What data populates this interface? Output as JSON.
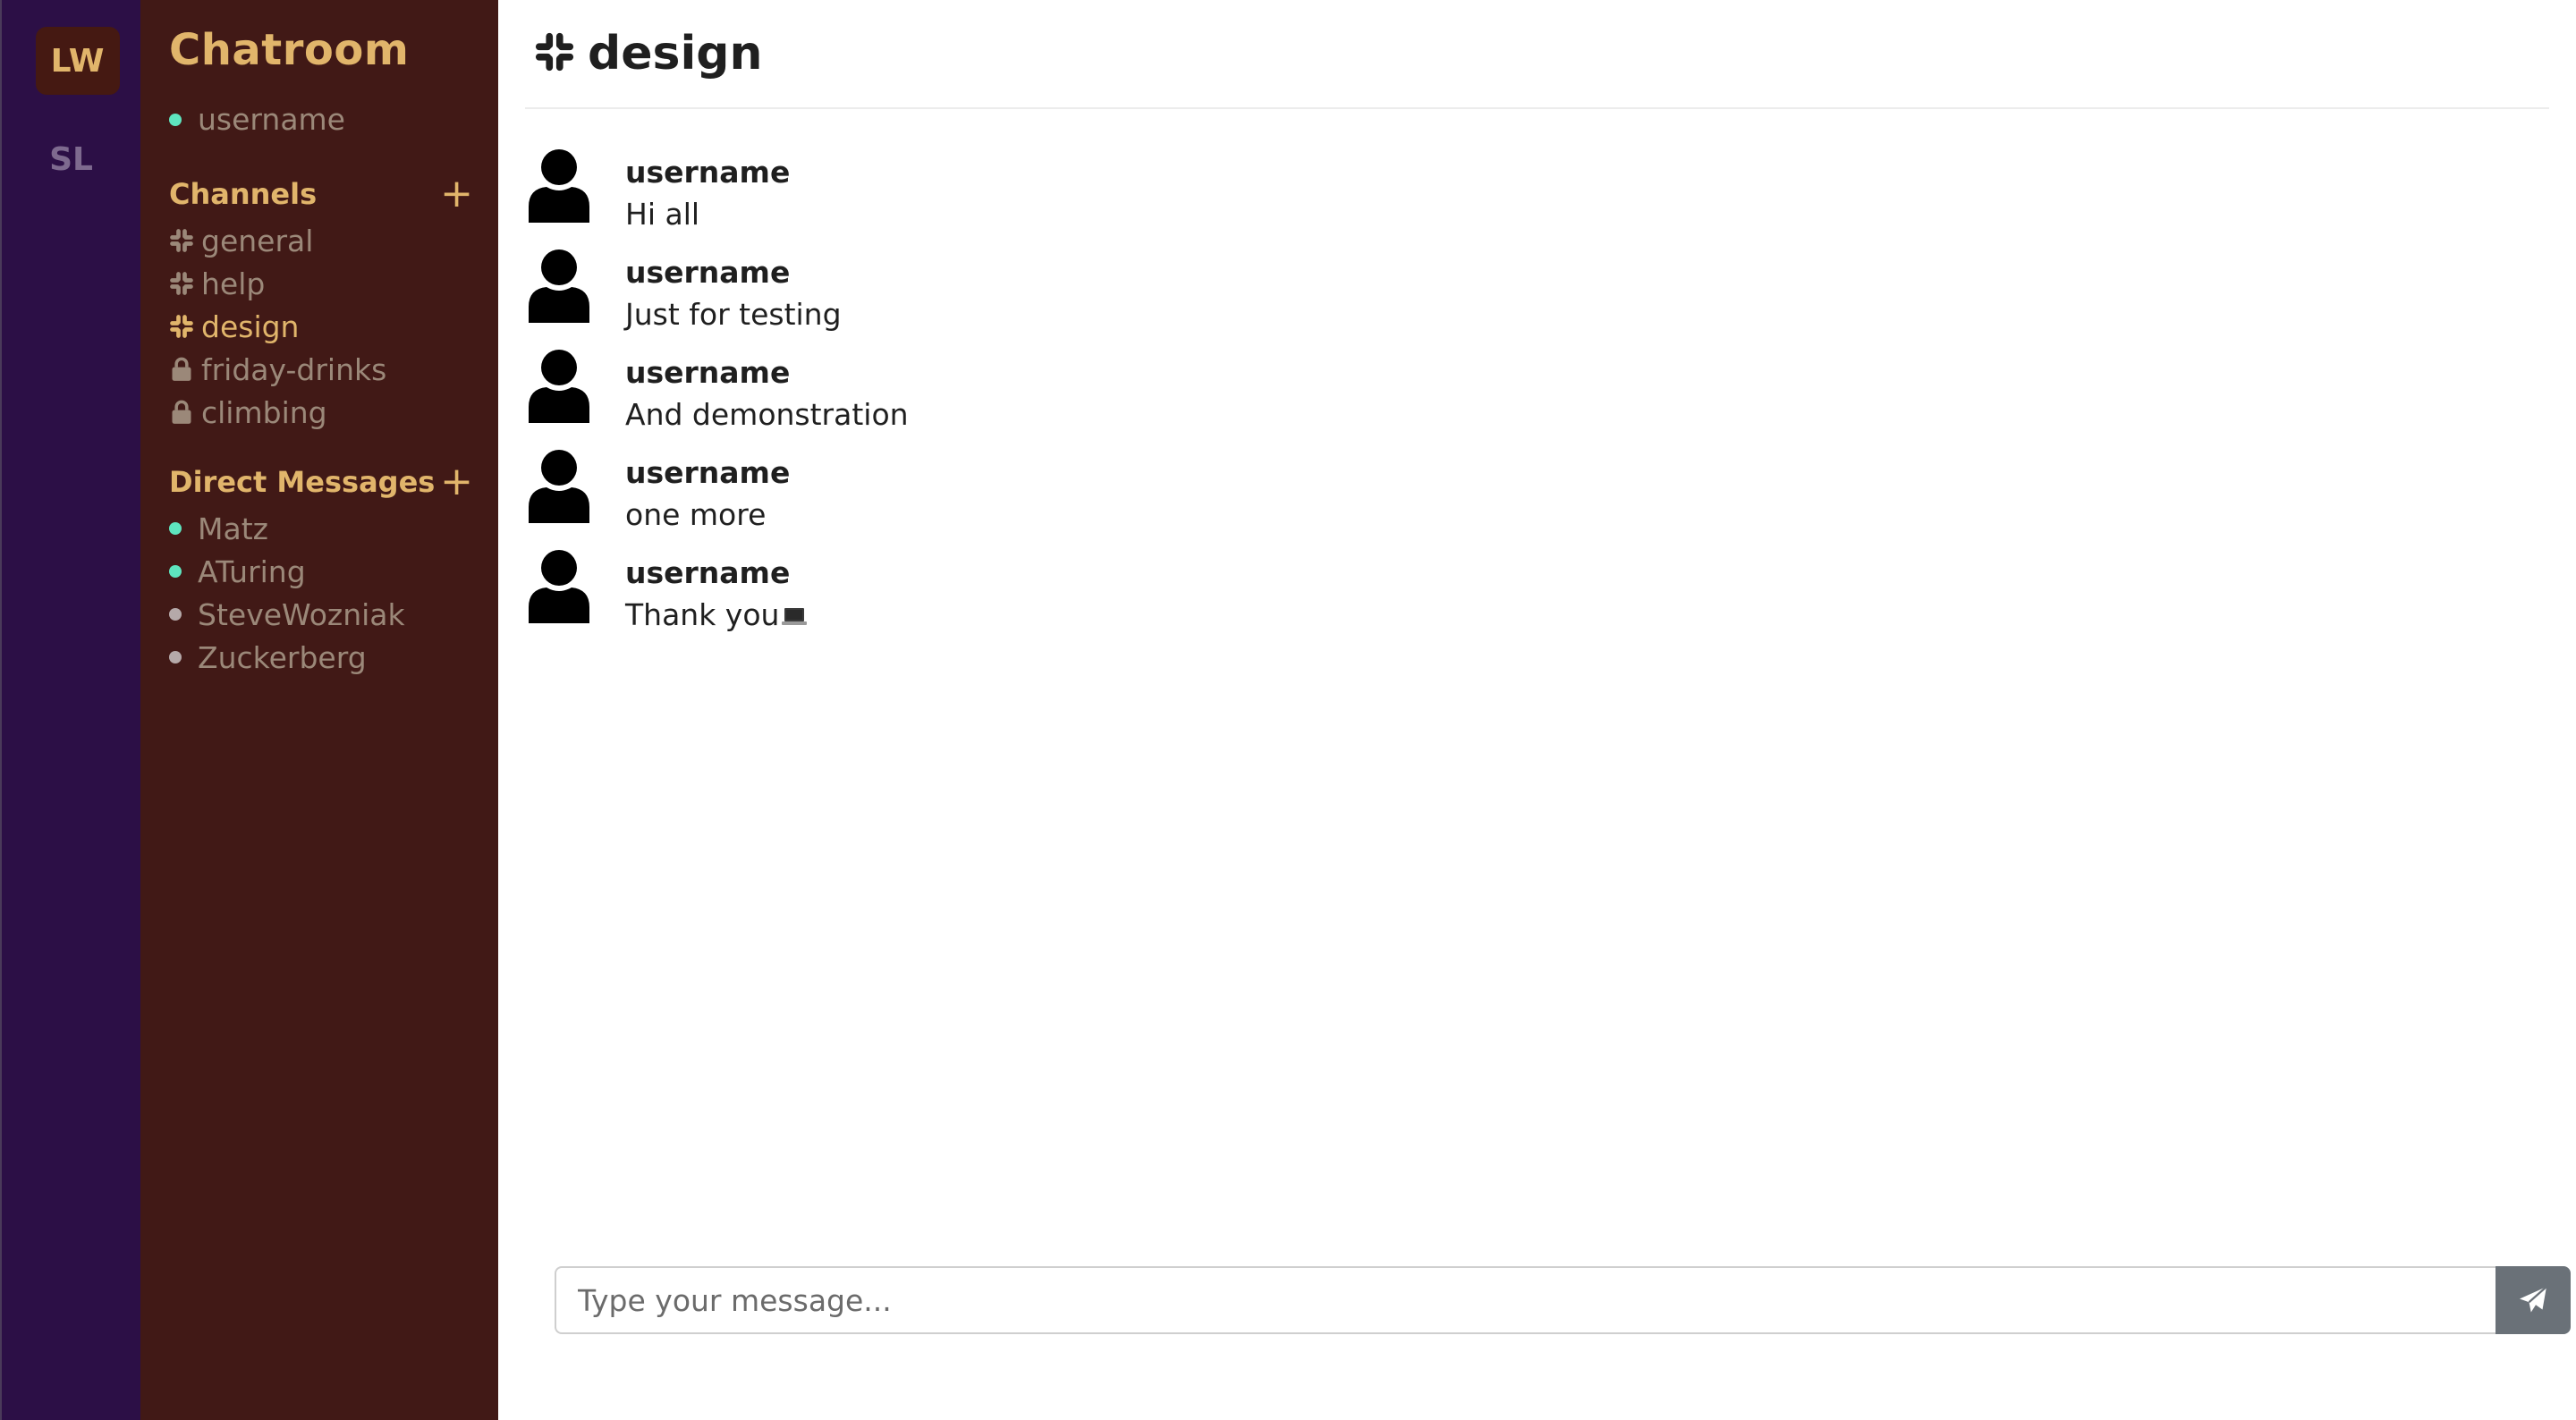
{
  "workspaces": [
    {
      "initials": "LW",
      "active": true
    },
    {
      "initials": "SL",
      "active": false
    }
  ],
  "sidebar": {
    "title": "Chatroom",
    "current_user": {
      "name": "username",
      "status": "online"
    },
    "channels_header": "Channels",
    "channels": [
      {
        "name": "general",
        "icon": "slack-hash-icon",
        "private": false,
        "active": false
      },
      {
        "name": "help",
        "icon": "slack-hash-icon",
        "private": false,
        "active": false
      },
      {
        "name": "design",
        "icon": "slack-hash-icon",
        "private": false,
        "active": true
      },
      {
        "name": "friday-drinks",
        "icon": "lock-icon",
        "private": true,
        "active": false
      },
      {
        "name": "climbing",
        "icon": "lock-icon",
        "private": true,
        "active": false
      }
    ],
    "dm_header": "Direct Messages",
    "direct_messages": [
      {
        "name": "Matz",
        "status": "online"
      },
      {
        "name": "ATuring",
        "status": "online"
      },
      {
        "name": "SteveWozniak",
        "status": "offline"
      },
      {
        "name": "Zuckerberg",
        "status": "offline"
      }
    ]
  },
  "main": {
    "channel_title": "design",
    "messages": [
      {
        "author": "username",
        "text": "Hi all"
      },
      {
        "author": "username",
        "text": "Just for testing"
      },
      {
        "author": "username",
        "text": "And demonstration"
      },
      {
        "author": "username",
        "text": "one more"
      },
      {
        "author": "username",
        "text": "Thank you",
        "emoji": "laptop-icon"
      }
    ],
    "composer": {
      "placeholder": "Type your message...",
      "send_icon": "paper-plane-icon"
    }
  },
  "colors": {
    "rail_bg": "#2c0f46",
    "sidebar_bg": "#411916",
    "accent": "#e1b56b",
    "online": "#5ee5bf",
    "offline": "#b5a9a9",
    "send_button": "#6a7178"
  }
}
